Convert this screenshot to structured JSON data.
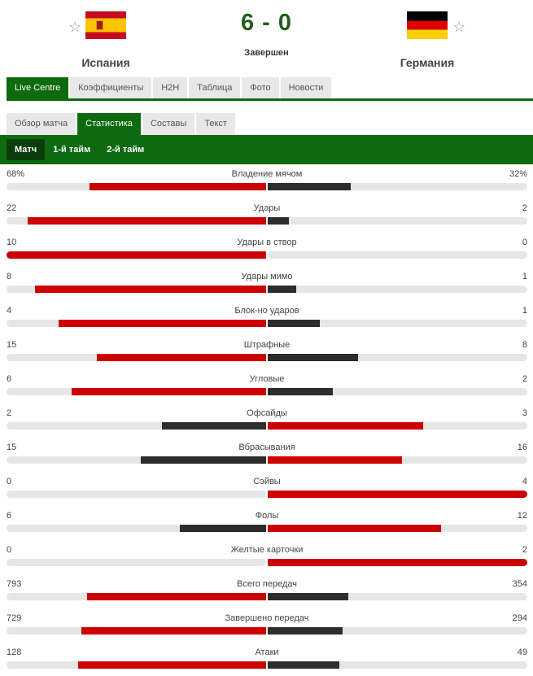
{
  "match": {
    "home": {
      "name": "Испания",
      "flag": "flag-spain"
    },
    "away": {
      "name": "Германия",
      "flag": "flag-germany"
    },
    "score": "6 - 0",
    "status": "Завершен",
    "star_glyph": "☆"
  },
  "tabs_main": [
    "Live Centre",
    "Коэффициенты",
    "H2H",
    "Таблица",
    "Фото",
    "Новости"
  ],
  "tabs_main_active": 0,
  "tabs_sub": [
    "Обзор матча",
    "Статистика",
    "Составы",
    "Текст"
  ],
  "tabs_sub_active": 1,
  "periods": [
    "Матч",
    "1-й тайм",
    "2-й тайм"
  ],
  "periods_active": 0,
  "colors": {
    "green": "#0e6a0e",
    "red": "#cc0000",
    "dark": "#2d2d2d",
    "track": "#e6e6e6"
  },
  "stats": [
    {
      "name": "Владение мячом",
      "home": "68%",
      "away": "32%",
      "home_share": 0.68,
      "away_share": 0.32,
      "leader": "home"
    },
    {
      "name": "Удары",
      "home": "22",
      "away": "2",
      "home_share": 0.917,
      "away_share": 0.083,
      "leader": "home"
    },
    {
      "name": "Удары в створ",
      "home": "10",
      "away": "0",
      "home_share": 1.0,
      "away_share": 0.0,
      "leader": "home"
    },
    {
      "name": "Удары мимо",
      "home": "8",
      "away": "1",
      "home_share": 0.889,
      "away_share": 0.111,
      "leader": "home"
    },
    {
      "name": "Блок-но ударов",
      "home": "4",
      "away": "1",
      "home_share": 0.8,
      "away_share": 0.2,
      "leader": "home"
    },
    {
      "name": "Штрафные",
      "home": "15",
      "away": "8",
      "home_share": 0.652,
      "away_share": 0.348,
      "leader": "home"
    },
    {
      "name": "Угловые",
      "home": "6",
      "away": "2",
      "home_share": 0.75,
      "away_share": 0.25,
      "leader": "home"
    },
    {
      "name": "Офсайды",
      "home": "2",
      "away": "3",
      "home_share": 0.4,
      "away_share": 0.6,
      "leader": "away"
    },
    {
      "name": "Вбрасывания",
      "home": "15",
      "away": "16",
      "home_share": 0.484,
      "away_share": 0.516,
      "leader": "away"
    },
    {
      "name": "Сэйвы",
      "home": "0",
      "away": "4",
      "home_share": 0.0,
      "away_share": 1.0,
      "leader": "away"
    },
    {
      "name": "Фолы",
      "home": "6",
      "away": "12",
      "home_share": 0.333,
      "away_share": 0.667,
      "leader": "away"
    },
    {
      "name": "Желтые карточки",
      "home": "0",
      "away": "2",
      "home_share": 0.0,
      "away_share": 1.0,
      "leader": "away"
    },
    {
      "name": "Всего передач",
      "home": "793",
      "away": "354",
      "home_share": 0.691,
      "away_share": 0.309,
      "leader": "home"
    },
    {
      "name": "Завершено передач",
      "home": "729",
      "away": "294",
      "home_share": 0.713,
      "away_share": 0.287,
      "leader": "home"
    },
    {
      "name": "Атаки",
      "home": "128",
      "away": "49",
      "home_share": 0.723,
      "away_share": 0.277,
      "leader": "home"
    }
  ]
}
